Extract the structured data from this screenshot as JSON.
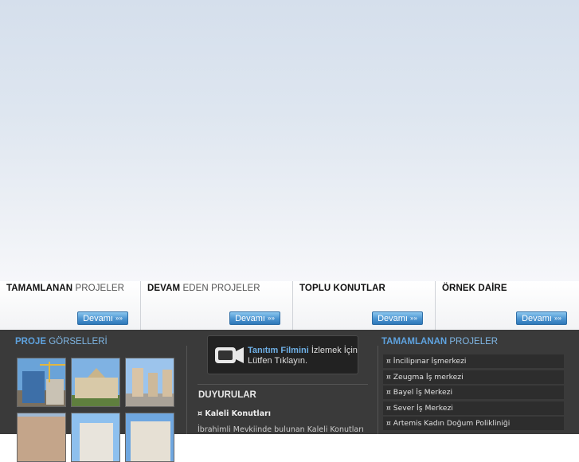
{
  "tabs": [
    {
      "bold": "TAMAMLANAN",
      "rest": " PROJELER",
      "button": "Devamı"
    },
    {
      "bold": "DEVAM",
      "rest": " EDEN PROJELER",
      "button": "Devamı"
    },
    {
      "bold": "TOPLU KONUTLAR",
      "rest": "",
      "button": "Devamı"
    },
    {
      "bold": "ÖRNEK DAİRE",
      "rest": "",
      "button": "Devamı"
    }
  ],
  "gallery": {
    "title_bold": "PROJE",
    "title_rest": " GÖRSELLERİ"
  },
  "video": {
    "line1_bold": "Tanıtım Filmini",
    "line1_rest": " İzlemek İçin",
    "line2": "Lütfen Tıklayın."
  },
  "announcements": {
    "title": "DUYURULAR",
    "item_title": "¤ Kaleli Konutları",
    "item_text": "İbrahimli Mevkiinde bulunan Kaleli Konutları"
  },
  "completed": {
    "title_bold": "TAMAMLANAN",
    "title_rest": " PROJELER",
    "items": [
      "¤ İncilipınar İşmerkezi",
      "¤ Zeugma İş merkezi",
      "¤ Bayel İş Merkezi",
      "¤ Sever İş Merkezi",
      "¤ Artemis Kadın Doğum Polikliniği"
    ]
  }
}
